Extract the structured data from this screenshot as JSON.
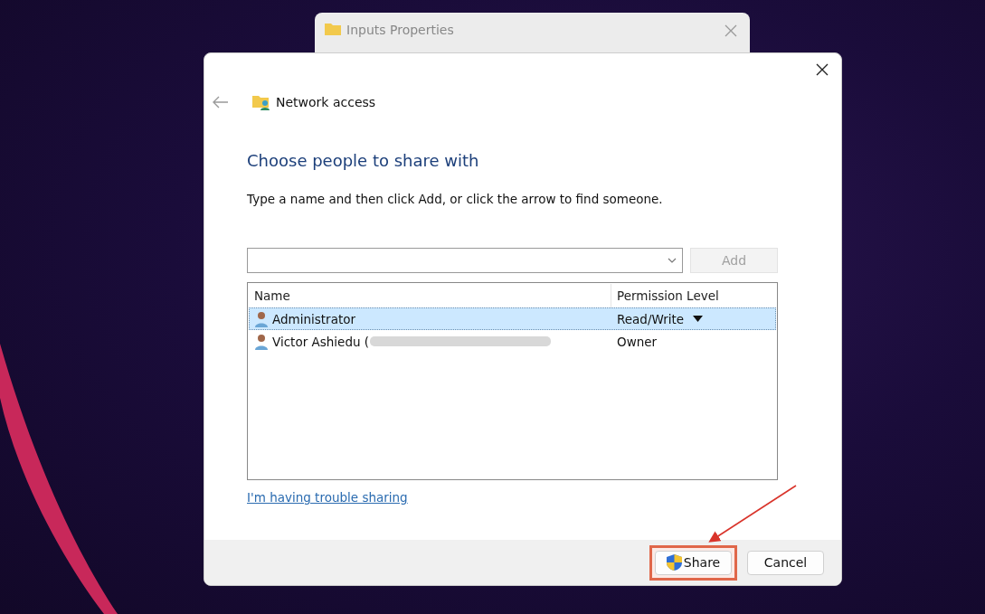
{
  "background_window": {
    "title": "Inputs Properties"
  },
  "dialog": {
    "title": "Network access",
    "heading": "Choose people to share with",
    "instruction": "Type a name and then click Add, or click the arrow to find someone.",
    "add_button": {
      "label": "Add",
      "disabled": true
    },
    "table": {
      "columns": [
        "Name",
        "Permission Level"
      ],
      "rows": [
        {
          "name": "Administrator",
          "permission": "Read/Write",
          "selected": true,
          "has_dropdown": true,
          "redacted": false
        },
        {
          "name": "Victor Ashiedu (",
          "permission": "Owner",
          "selected": false,
          "has_dropdown": false,
          "redacted": true
        }
      ]
    },
    "help_link": "I'm having trouble sharing",
    "buttons": [
      {
        "label": "Share",
        "kind": "shield",
        "highlighted": true
      },
      {
        "label": "Cancel",
        "kind": "plain",
        "highlighted": false
      }
    ]
  }
}
